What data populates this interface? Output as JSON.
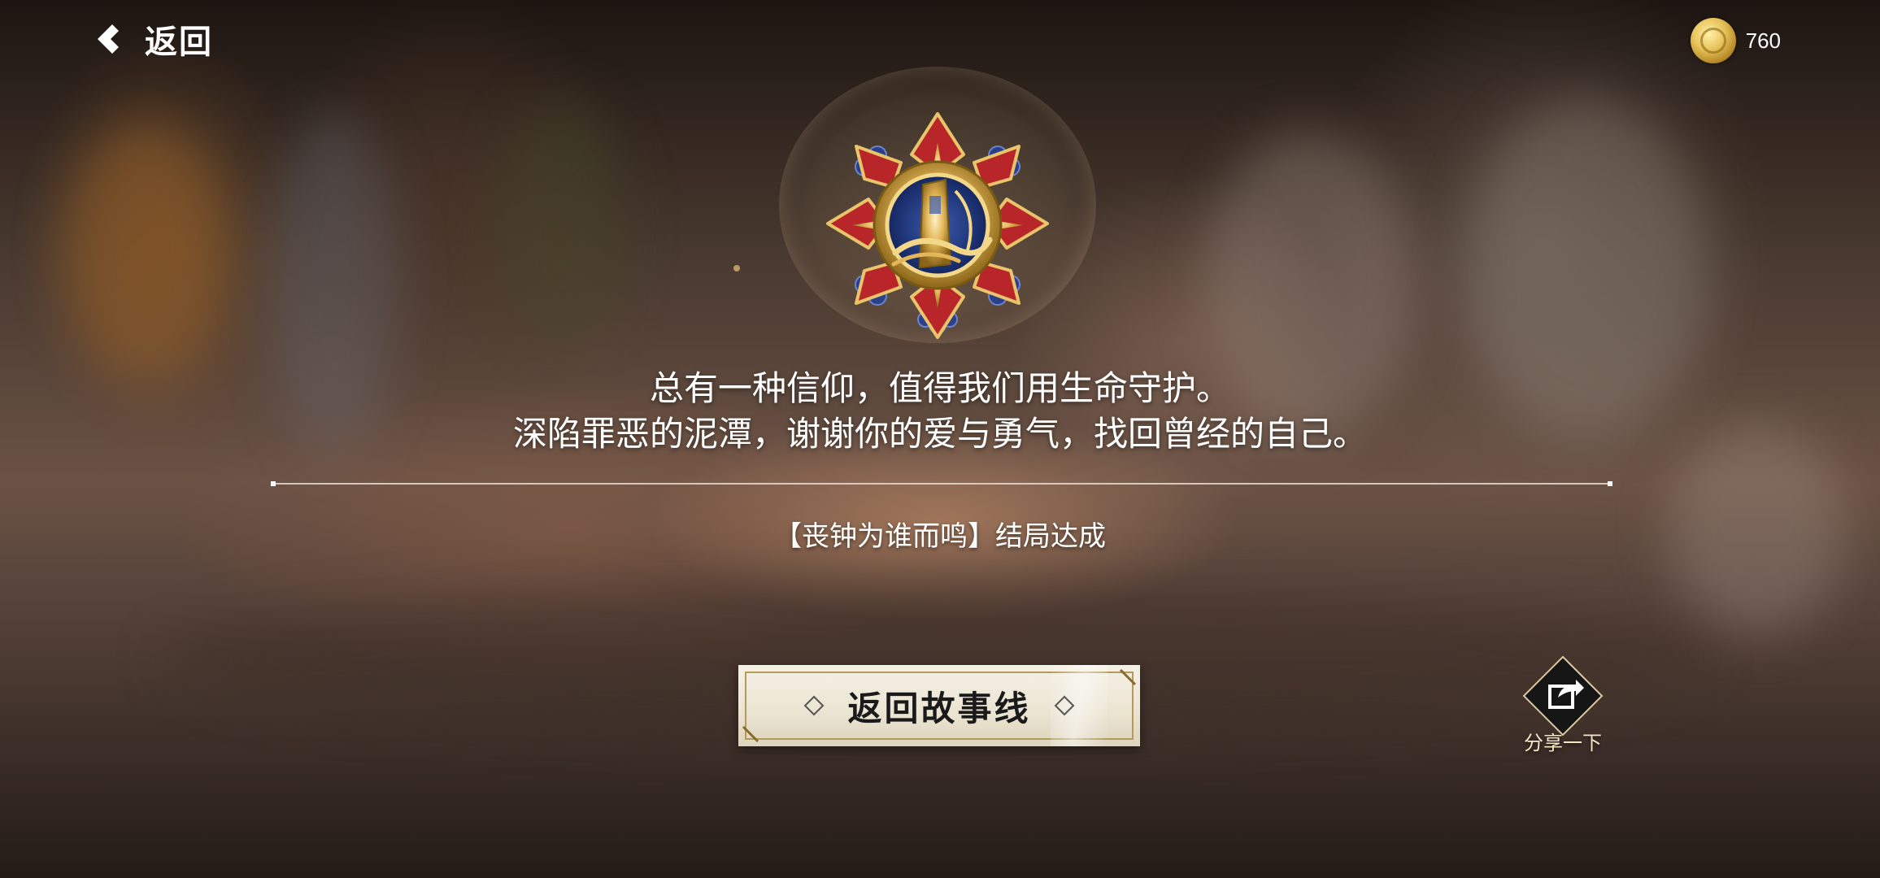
{
  "header": {
    "back_label": "返回",
    "back_icon": "back-chevron-icon",
    "coin_icon": "gold-coin-icon",
    "coin_value": "760"
  },
  "medal": {
    "icon": "medal-badge-icon"
  },
  "message": {
    "line1": "总有一种信仰，值得我们用生命守护。",
    "line2": "深陷罪恶的泥潭，谢谢你的爱与勇气，找回曾经的自己。"
  },
  "ending": {
    "text": "【丧钟为谁而鸣】结局达成"
  },
  "actions": {
    "return_story_label": "返回故事线",
    "share_label": "分享一下",
    "share_icon": "share-icon"
  },
  "colors": {
    "accent_gold": "#d8b070",
    "button_bg": "#f0ebdc",
    "button_border": "#b59a5e",
    "medal_red": "#b8262a",
    "medal_blue": "#2c3f8a"
  }
}
